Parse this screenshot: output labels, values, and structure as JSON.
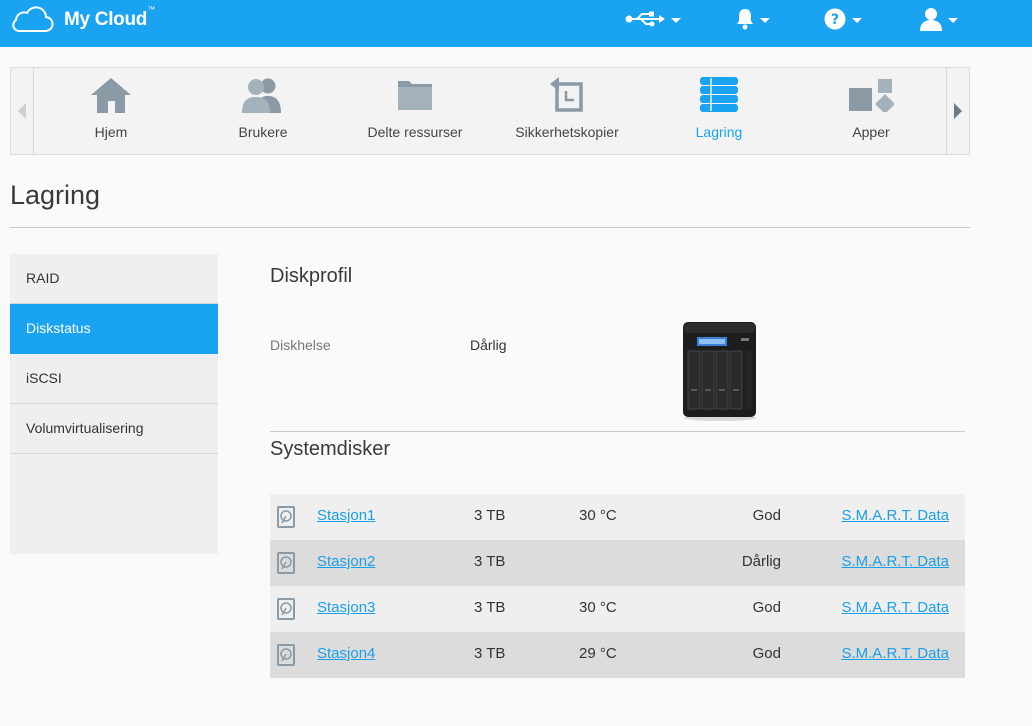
{
  "app": {
    "logo_text": "My Cloud",
    "logo_tm": "™"
  },
  "colors": {
    "accent": "#1aa3f0",
    "link": "#1a9fe8"
  },
  "topbar": {
    "icons": [
      "usb-icon",
      "bell-icon",
      "help-icon",
      "user-icon"
    ]
  },
  "nav": {
    "items": [
      {
        "label": "Hjem",
        "icon": "home-icon"
      },
      {
        "label": "Brukere",
        "icon": "users-icon"
      },
      {
        "label": "Delte ressurser",
        "icon": "folder-icon"
      },
      {
        "label": "Sikkerhetskopier",
        "icon": "backup-icon"
      },
      {
        "label": "Lagring",
        "icon": "storage-icon",
        "active": true
      },
      {
        "label": "Apper",
        "icon": "apps-icon"
      }
    ]
  },
  "page": {
    "title": "Lagring"
  },
  "sidebar": {
    "items": [
      {
        "label": "RAID"
      },
      {
        "label": "Diskstatus",
        "active": true
      },
      {
        "label": "iSCSI"
      },
      {
        "label": "Volumvirtualisering"
      }
    ]
  },
  "diskprofile": {
    "title": "Diskprofil",
    "health_label": "Diskhelse",
    "health_value": "Dårlig"
  },
  "systemdisks": {
    "title": "Systemdisker",
    "rows": [
      {
        "name": "Stasjon1",
        "size": "3 TB",
        "temp": "30 °C",
        "health": "God",
        "smart": "S.M.A.R.T. Data"
      },
      {
        "name": "Stasjon2",
        "size": "3 TB",
        "temp": "",
        "health": "Dårlig",
        "smart": "S.M.A.R.T. Data"
      },
      {
        "name": "Stasjon3",
        "size": "3 TB",
        "temp": "30 °C",
        "health": "God",
        "smart": "S.M.A.R.T. Data"
      },
      {
        "name": "Stasjon4",
        "size": "3 TB",
        "temp": "29 °C",
        "health": "God",
        "smart": "S.M.A.R.T. Data"
      }
    ]
  }
}
